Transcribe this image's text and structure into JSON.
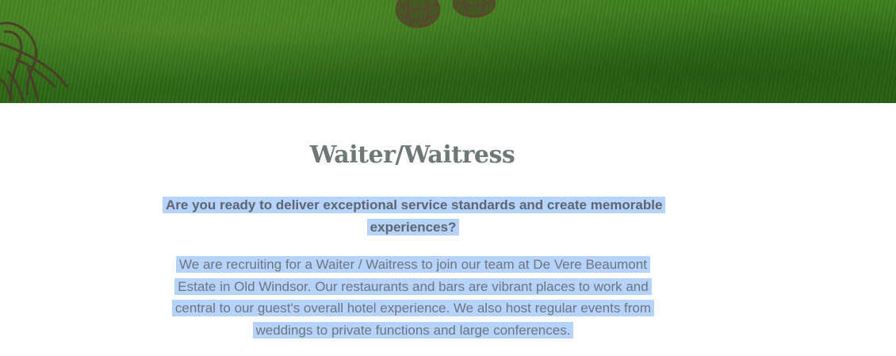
{
  "hero": {
    "image_icon": "garden-lawn-wicker-sculptures",
    "grass_color": "#2f6e16"
  },
  "job": {
    "title": "Waiter/Waitress",
    "headline": "Are you ready to deliver exceptional service standards and create memorable experiences?",
    "intro": "We are recruiting for a Waiter / Waitress to join our team at De Vere Beaumont Estate in Old Windsor. Our restaurants and bars are vibrant places to work and central to our guest's overall hotel experience. We also host regular events from weddings to private functions and large conferences."
  },
  "colors": {
    "selection_highlight": "#b5d3fb",
    "title_text": "#6f7878",
    "body_text": "#6d7580"
  }
}
